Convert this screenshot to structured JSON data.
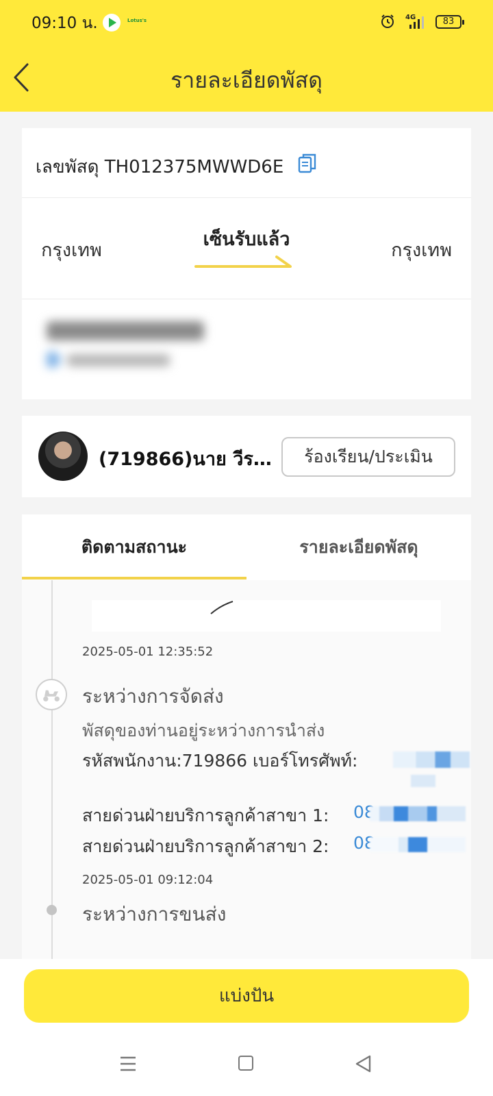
{
  "status_bar": {
    "time": "09:10 น.",
    "app_label": "Lotus's",
    "battery": "83",
    "network": "4G"
  },
  "header": {
    "title": "รายละเอียดพัสดุ"
  },
  "parcel": {
    "tracking_label": "เลขพัสดุ TH012375MWWD6E",
    "origin_city": "กรุงเทพ",
    "status": "เซ็นรับแล้ว",
    "destination_city": "กรุงเทพ"
  },
  "courier": {
    "name": "(719866)นาย วีระชั...",
    "complain_button": "ร้องเรียน/ประเมิน"
  },
  "tabs": [
    {
      "label": "ติดตามสถานะ"
    },
    {
      "label": "รายละเอียดพัสดุ"
    }
  ],
  "timeline": [
    {
      "time": "2025-05-01 12:35:52",
      "title": "ระหว่างการจัดส่ง",
      "description": "พัสดุของท่านอยู่ระหว่างการนำส่ง",
      "staff_line": "รหัสพนักงาน:719866  เบอร์โทรศัพท์:",
      "hotline1_label": "สายด่วนฝ่ายบริการลูกค้าสาขา 1:",
      "hotline1_value": "08",
      "hotline2_label": "สายด่วนฝ่ายบริการลูกค้าสาขา 2:",
      "hotline2_value": "08"
    },
    {
      "time": "2025-05-01 09:12:04",
      "title": "ระหว่างการขนส่ง"
    }
  ],
  "bottom": {
    "button_label": "แบ่งปัน"
  },
  "colors": {
    "accent_yellow": "#ffe93a",
    "link_blue": "#3a8ad6",
    "tab_underline": "#f2d24a"
  },
  "icons": {
    "back": "chevron-left-icon",
    "copy": "copy-icon",
    "route": "arrow-right-icon",
    "event_delivery": "scooter-icon",
    "nav_menu": "menu-icon",
    "nav_home": "square-icon",
    "nav_back": "triangle-back-icon"
  }
}
